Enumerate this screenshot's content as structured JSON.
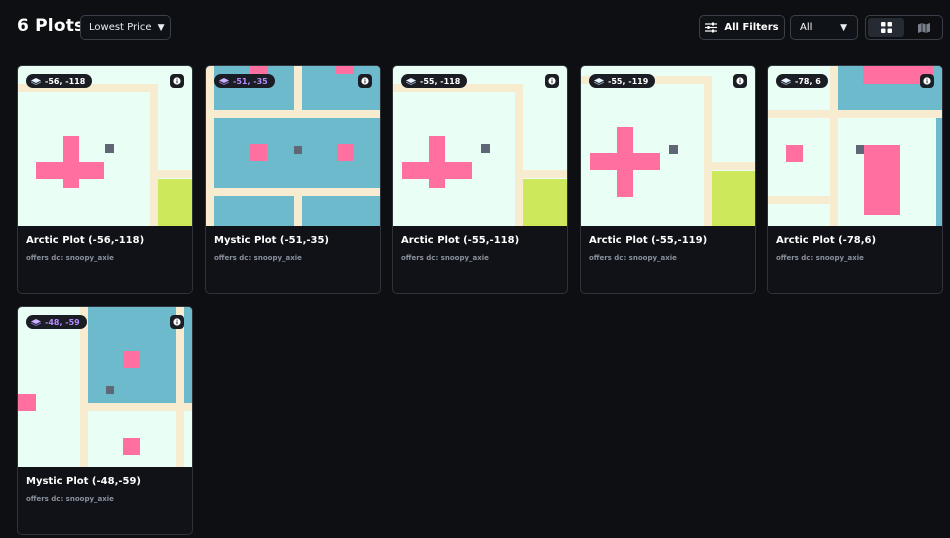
{
  "header": {
    "title": "6 Plots",
    "sort_label": "Lowest Price",
    "filters_label": "All Filters",
    "type_select": "All"
  },
  "icons": {
    "caret": "caret-down-icon",
    "filters": "sliders-icon",
    "grid_view": "grid-icon",
    "map_view": "map-icon",
    "info": "info-icon",
    "plot": "plot-icon"
  },
  "colors": {
    "background": "#0d0f13",
    "arctic_ground": "#e9fff5",
    "mystic_water": "#6cbacb",
    "road": "#f7eccf",
    "building": "#ff6fa0",
    "grass": "#cde85a",
    "mystic_badge": "#b58bff"
  },
  "plots": [
    {
      "coords": "-56, -118",
      "name": "Arctic Plot (-56,-118)",
      "offer": "offers dc: snoopy_axie",
      "type": "arctic"
    },
    {
      "coords": "-51, -35",
      "name": "Mystic Plot (-51,-35)",
      "offer": "offers dc: snoopy_axie",
      "type": "mystic"
    },
    {
      "coords": "-55, -118",
      "name": "Arctic Plot (-55,-118)",
      "offer": "offers dc: snoopy_axie",
      "type": "arctic"
    },
    {
      "coords": "-55, -119",
      "name": "Arctic Plot (-55,-119)",
      "offer": "offers dc: snoopy_axie",
      "type": "arctic"
    },
    {
      "coords": "-78, 6",
      "name": "Arctic Plot (-78,6)",
      "offer": "offers dc: snoopy_axie",
      "type": "arctic"
    },
    {
      "coords": "-48, -59",
      "name": "Mystic Plot (-48,-59)",
      "offer": "offers dc: snoopy_axie",
      "type": "mystic"
    }
  ]
}
